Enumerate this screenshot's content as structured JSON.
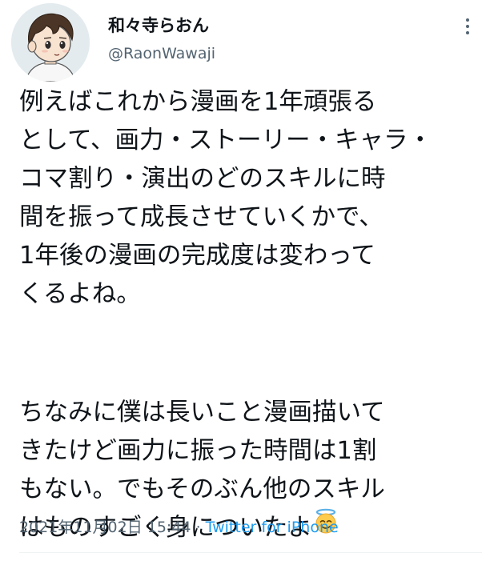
{
  "author": {
    "display_name": "和々寺らおん",
    "handle": "@RaonWawaji",
    "avatar_icon": "anime-boy-avatar"
  },
  "header": {
    "more_icon": "more-vertical-icon"
  },
  "tweet": {
    "lines": [
      "例えばこれから漫画を1年頑張る",
      "として、画力・ストーリー・キャラ・",
      "コマ割り・演出のどのスキルに時",
      "間を振って成長させていくかで、",
      "1年後の漫画の完成度は変わって",
      "くるよね。",
      "ちなみに僕は長いこと漫画描いて",
      "きたけど画力に振った時間は1割",
      "もない。でもそのぶん他のスキル",
      "はものすごく身についたよ"
    ],
    "emoji": "smiling-face-with-halo-icon"
  },
  "meta": {
    "timestamp": "2021年11月02日 15:44",
    "separator": "·",
    "source": "Twitter for iPhone"
  },
  "colors": {
    "text": "#0f1419",
    "secondary": "#536471",
    "link": "#1d9bf0",
    "divider": "#eff3f4"
  }
}
